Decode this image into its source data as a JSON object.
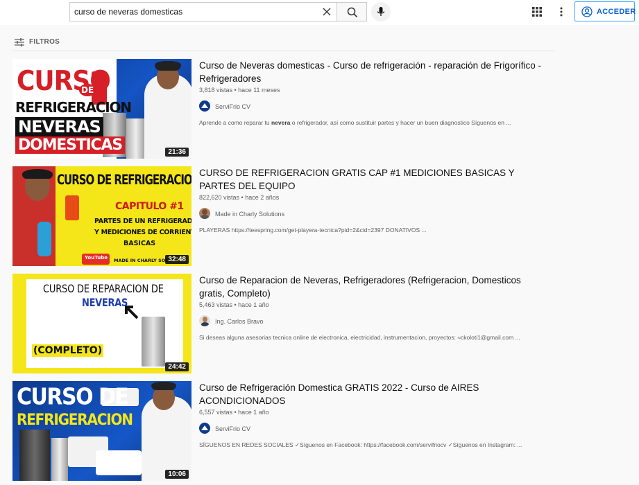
{
  "search": {
    "query": "curso de neveras domesticas"
  },
  "header": {
    "login_label": "ACCEDER"
  },
  "filters": {
    "label": "FILTROS"
  },
  "results": [
    {
      "title": "Curso de Neveras domesticas - Curso de refrigeración - reparación de Frigorífico - Refrigeradores",
      "views": "3,818 vistas",
      "age": "hace 11 meses",
      "meta": "3,818 vistas • hace 11 meses",
      "channel": "ServiFrio CV",
      "desc_pre": "Aprende a como reparar tu ",
      "desc_bold": "nevera",
      "desc_post": " o refrigerador, así como sustituir partes y hacer un buen diagnostico Síguenos en ...",
      "duration": "21:36",
      "thumb_text": {
        "l1": "CURSO",
        "l2": "DE",
        "l3": "REFRIGERACION",
        "l4": "NEVERAS",
        "l5": "DOMESTICAS"
      }
    },
    {
      "title": "CURSO DE REFRIGERACION GRATIS CAP #1 MEDICIONES BASICAS Y PARTES DEL EQUIPO",
      "meta": "822,620 vistas • hace 2 años",
      "channel": "Made in Charly Solutions",
      "desc": "PLAYERAS https://teespring.com/get-playera-tecnica?pid=2&cid=2397 DONATIVOS ...",
      "duration": "32:48",
      "thumb_text": {
        "l1": "CURSO DE REFRIGERACION GRATIS",
        "l2": "CAPITULO #1",
        "l3": "PARTES DE UN REFRIGERADOR",
        "l4": "Y MEDICIONES DE CORRIENTE",
        "l5": "BASICAS",
        "l6": "MADE IN CHARLY SOLUT",
        "l7": "YouTube"
      }
    },
    {
      "title": "Curso de Reparacion de Neveras, Refrigeradores (Refrigeracion, Domesticos gratis, Completo)",
      "meta": "5,463 vistas • hace 1 año",
      "channel": "Ing. Carlos Bravo",
      "desc": "Si deseas alguna asesorias tecnica online de electronica, electricidad, instrumentacion, proyectos: ≈ckoloti1@gmail.com ...",
      "duration": "24:42",
      "thumb_text": {
        "l1": "CURSO DE REPARACION DE",
        "l2": "NEVERAS",
        "l3": "(COMPLETO)"
      }
    },
    {
      "title": "Curso de Refrigeración Domestica GRATIS 2022 - Curso de AIRES ACONDICIONADOS",
      "meta": "6,557 vistas • hace 1 año",
      "channel": "ServiFrio CV",
      "desc": "SÍGUENOS EN REDES SOCIALES ✓Síguenos en Facebook: https://facebook.com/servifriocv ✓Síguenos en Instagram: ...",
      "duration": "10:06",
      "thumb_text": {
        "l1": "CURSO DE",
        "l2": "REFRIGERACION"
      }
    }
  ]
}
